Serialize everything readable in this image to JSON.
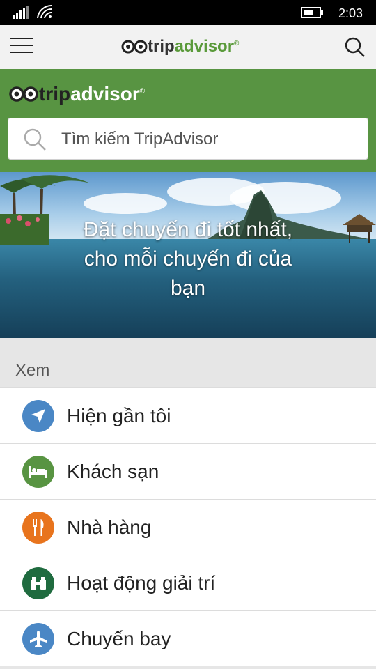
{
  "status_bar": {
    "time": "2:03"
  },
  "app_bar": {
    "logo_trip": "trip",
    "logo_advisor": "advisor",
    "logo_reg": "®"
  },
  "header": {
    "logo_trip": "trip",
    "logo_advisor": "advisor",
    "logo_reg": "®"
  },
  "search": {
    "placeholder": "Tìm kiếm TripAdvisor"
  },
  "hero": {
    "caption_line1": "Đặt chuyến đi tốt nhất,",
    "caption_line2": "cho mỗi chuyến đi của",
    "caption_line3": "bạn"
  },
  "section": {
    "label": "Xem"
  },
  "items": [
    {
      "label": "Hiện gần tôi",
      "icon": "navigation-arrow-icon",
      "color": "#4a87c5"
    },
    {
      "label": "Khách sạn",
      "icon": "bed-icon",
      "color": "#589442"
    },
    {
      "label": "Nhà hàng",
      "icon": "fork-knife-icon",
      "color": "#e8741d"
    },
    {
      "label": "Hoạt động giải trí",
      "icon": "binoculars-icon",
      "color": "#1f6b3f"
    },
    {
      "label": "Chuyến bay",
      "icon": "airplane-icon",
      "color": "#4a87c5"
    }
  ],
  "colors": {
    "brand_green": "#589442",
    "brand_green_text": "#5a9a3a"
  }
}
